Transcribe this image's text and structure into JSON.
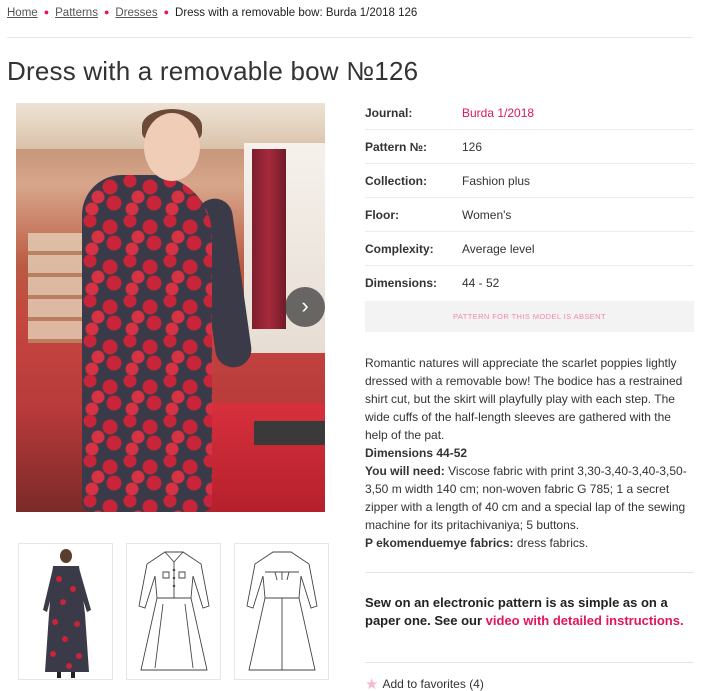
{
  "breadcrumb": {
    "items": [
      "Home",
      "Patterns",
      "Dresses"
    ],
    "current": "Dress with a removable bow: Burda 1/2018 126"
  },
  "title": "Dress with a removable bow №126",
  "specs": [
    {
      "label": "Journal:",
      "value": "Burda 1/2018"
    },
    {
      "label": "Pattern №:",
      "value": "126"
    },
    {
      "label": "Collection:",
      "value": "Fashion plus"
    },
    {
      "label": "Floor:",
      "value": "Women's"
    },
    {
      "label": "Complexity:",
      "value": "Average level"
    },
    {
      "label": "Dimensions:",
      "value": "44 - 52"
    }
  ],
  "absent_button": "PATTERN FOR THIS MODEL IS ABSENT",
  "description": {
    "intro": "Romantic natures will appreciate the scarlet poppies lightly dressed with a removable bow! The bodice has a restrained shirt cut, but the skirt will playfully play with each step. The wide cuffs of the half-length sleeves are gathered with the help of the pat.",
    "dimensions_line": "Dimensions 44-52",
    "you_need_label": "You will need:",
    "you_need_text": " Viscose fabric with print 3,30-3,40-3,40-3,50-3,50 m width 140 cm; non-woven fabric G 785; 1 a secret zipper with a length of 40 cm and a special lap of the sewing machine for its pritachivaniya; 5 buttons.",
    "fabrics_label": "P ekomenduemye fabrics:",
    "fabrics_text": " dress fabrics."
  },
  "electronic": {
    "text": "Sew on an electronic pattern is as simple as on a paper one. See our ",
    "link": "video with detailed instructions."
  },
  "favorites": {
    "label": "Add to favorites",
    "count": "(4)"
  },
  "colors": {
    "accent": "#e2145e",
    "muted_button_text": "#f08aa8"
  },
  "icons": {
    "next": "chevron-right-icon",
    "favorite": "star-icon",
    "separator": "bullet-icon"
  }
}
